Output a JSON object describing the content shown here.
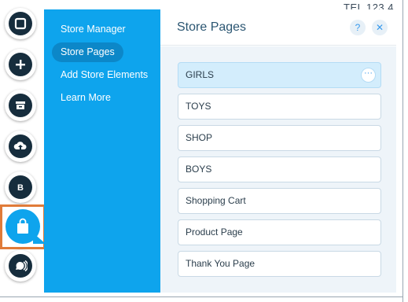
{
  "background": {
    "phone_text": "TEL 123 4"
  },
  "rail": {
    "items": [
      {
        "name": "pages-icon"
      },
      {
        "name": "add-icon"
      },
      {
        "name": "store-icon"
      },
      {
        "name": "upload-icon"
      },
      {
        "name": "blog-icon",
        "glyph": "B"
      },
      {
        "name": "shopping-bag-icon"
      },
      {
        "name": "chat-icon"
      }
    ]
  },
  "menu": {
    "items": [
      {
        "label": "Store Manager",
        "active": false
      },
      {
        "label": "Store Pages",
        "active": true
      },
      {
        "label": "Add Store Elements",
        "active": false
      },
      {
        "label": "Learn More",
        "active": false
      }
    ]
  },
  "panel": {
    "title": "Store Pages",
    "help_label": "?",
    "close_label": "✕",
    "pages": [
      {
        "label": "GIRLS",
        "selected": true,
        "more_label": "···"
      },
      {
        "label": "TOYS",
        "selected": false
      },
      {
        "label": "SHOP",
        "selected": false
      },
      {
        "label": "BOYS",
        "selected": false
      },
      {
        "label": "Shopping Cart",
        "selected": false
      },
      {
        "label": "Product Page",
        "selected": false
      },
      {
        "label": "Thank You Page",
        "selected": false
      }
    ]
  },
  "colors": {
    "menu_bg": "#0ea4ed",
    "menu_active": "#0c87c8",
    "rail_icon": "#162d3d",
    "highlight_border": "#e07b39",
    "selected_page": "#d3edfc"
  }
}
